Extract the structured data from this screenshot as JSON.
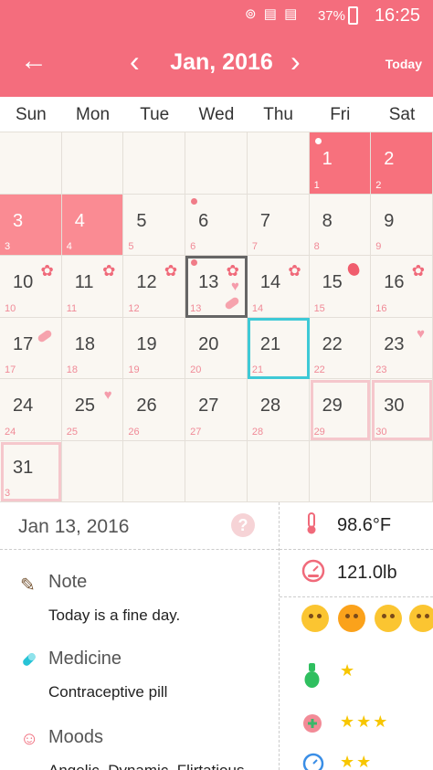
{
  "status": {
    "time": "16:25",
    "battery": "37%",
    "icons": "⊚ ▤ ▤"
  },
  "header": {
    "title": "Jan, 2016",
    "today": "Today",
    "back_icon": "←",
    "prev_icon": "‹",
    "next_icon": "›"
  },
  "weekdays": [
    "Sun",
    "Mon",
    "Tue",
    "Wed",
    "Thu",
    "Fri",
    "Sat"
  ],
  "days": [
    {
      "n": "",
      "s": ""
    },
    {
      "n": "",
      "s": ""
    },
    {
      "n": "",
      "s": ""
    },
    {
      "n": "",
      "s": ""
    },
    {
      "n": "",
      "s": ""
    },
    {
      "n": "1",
      "s": "1"
    },
    {
      "n": "2",
      "s": "2"
    },
    {
      "n": "3",
      "s": "3"
    },
    {
      "n": "4",
      "s": "4"
    },
    {
      "n": "5",
      "s": "5"
    },
    {
      "n": "6",
      "s": "6"
    },
    {
      "n": "7",
      "s": "7"
    },
    {
      "n": "8",
      "s": "8"
    },
    {
      "n": "9",
      "s": "9"
    },
    {
      "n": "10",
      "s": "10"
    },
    {
      "n": "11",
      "s": "11"
    },
    {
      "n": "12",
      "s": "12"
    },
    {
      "n": "13",
      "s": "13"
    },
    {
      "n": "14",
      "s": "14"
    },
    {
      "n": "15",
      "s": "15"
    },
    {
      "n": "16",
      "s": "16"
    },
    {
      "n": "17",
      "s": "17"
    },
    {
      "n": "18",
      "s": "18"
    },
    {
      "n": "19",
      "s": "19"
    },
    {
      "n": "20",
      "s": "20"
    },
    {
      "n": "21",
      "s": "21"
    },
    {
      "n": "22",
      "s": "22"
    },
    {
      "n": "23",
      "s": "23"
    },
    {
      "n": "24",
      "s": "24"
    },
    {
      "n": "25",
      "s": "25"
    },
    {
      "n": "26",
      "s": "26"
    },
    {
      "n": "27",
      "s": "27"
    },
    {
      "n": "28",
      "s": "28"
    },
    {
      "n": "29",
      "s": "29"
    },
    {
      "n": "30",
      "s": "30"
    },
    {
      "n": "31",
      "s": "3"
    },
    {
      "n": "",
      "s": ""
    },
    {
      "n": "",
      "s": ""
    },
    {
      "n": "",
      "s": ""
    },
    {
      "n": "",
      "s": ""
    },
    {
      "n": "",
      "s": ""
    },
    {
      "n": "",
      "s": ""
    }
  ],
  "detail": {
    "date": "Jan 13, 2016",
    "help": "?",
    "note_title": "Note",
    "note_body": "Today is a fine day.",
    "medicine_title": "Medicine",
    "medicine_body": "Contraceptive pill",
    "moods_title": "Moods",
    "moods_body": "Angelic, Dynamic, Flirtatious"
  },
  "right": {
    "temperature": "98.6°F",
    "weight": "121.0lb",
    "stars_1": "★",
    "stars_2": "★★★",
    "stars_3": "★★"
  },
  "colors": {
    "accent": "#f46d7d",
    "period": "#f7717d",
    "today": "#3ec9d6"
  }
}
